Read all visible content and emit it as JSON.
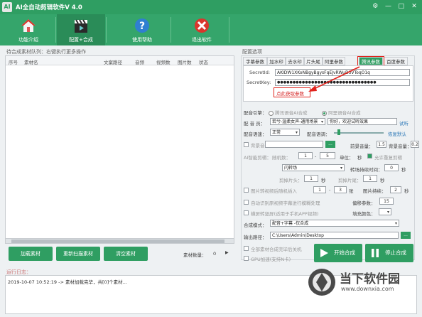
{
  "window": {
    "title": "AI全自动剪辑软件V 4.0",
    "logo_text": "AI"
  },
  "toolbar": [
    {
      "label": "功能介绍",
      "icon": "home-icon"
    },
    {
      "label": "配置+合成",
      "icon": "clapperboard-icon"
    },
    {
      "label": "使用帮助",
      "icon": "help-icon"
    },
    {
      "label": "退出软件",
      "icon": "exit-icon"
    }
  ],
  "left": {
    "section_title": "待合成素材队列：右键执行更多操作",
    "columns": [
      "序号",
      "素材名",
      "文案路径",
      "音频",
      "视频数",
      "图片数",
      "状态"
    ],
    "buttons": {
      "load": "加载素材",
      "rescan": "重新扫描素材",
      "clear": "清空素材"
    },
    "count_label": "素材数量：",
    "count_value": "0"
  },
  "right": {
    "section_title": "配置选项",
    "tabs": [
      "字幕参数",
      "加水印",
      "去水印",
      "片头尾",
      "阿里参数",
      "腾讯参数",
      "百度参数"
    ],
    "active_tab": "腾讯参数",
    "secret_id_label": "SecretId:",
    "secret_id_value": "AKIDW1XKoNBgyBgysFqEJvRWuD3VToqO1q",
    "secret_key_label": "SecretKey:",
    "secret_key_value": "●●●●●●●●●●●●●●●●●●●●●●●●●●●●●●●●",
    "get_params_link": "点此获取参数",
    "engine_label": "配音引擎：",
    "engine_opt1": "腾讯语音AI合成",
    "engine_opt2": "阿里语音AI合成",
    "voice_label": "配 音 员：",
    "voice_value": "若兮-温柔女声-通用场景",
    "voice_text_value": "你好，欢迎试听效果",
    "voice_try": "试听",
    "speed_label": "配音语速：",
    "speed_value": "正常",
    "tone_label": "配音语调：",
    "restore_default": "恢复默认",
    "bgm_label": "背景音",
    "foreground_vol_label": "前景音量：",
    "foreground_vol": "1.5",
    "bg_vol_label": "背景音量：",
    "bg_vol": "0.2",
    "ai_cut_label": "AI智能剪辑：",
    "random_label": "随机数：",
    "random_from": "1",
    "random_to": "5",
    "unit_label": "单位：",
    "unit_value": "秒",
    "allow_repeat": "允许重复剪辑",
    "transition_value": "闪转场",
    "transition_time_label": "转场持续时间：",
    "transition_time": "0",
    "seconds": "秒",
    "cut_head_label": "剪掉片头：",
    "cut_head": "1",
    "cut_tail_label": "剪掉片尾：",
    "cut_tail": "1",
    "image_insert_label": "图片转视频后随机插入",
    "image_from": "1",
    "image_to": "3",
    "image_unit": "张",
    "image_duration_label": "图片持续：",
    "image_duration": "2",
    "auto_blur_label": "自动识别原视频字幕进行模糊处理",
    "offset_label": "偏移参数：",
    "offset_value": "15",
    "vertical_fill_label": "横屏转竖屏(适用于手机APP视频)",
    "fill_color_label": "填充颜色：",
    "compose_mode_label": "合成模式：",
    "compose_mode_value": "配音+字幕 -仅合成",
    "output_label": "输出路径：",
    "output_value": "C:\\Users\\Admin\\Desktop",
    "output_browse": "...",
    "compose_all_label": "全部素材合成完毕后关机",
    "gpu_label": "GPU加速(支持N卡)",
    "start_button": "开始合成",
    "stop_button": "停止合成"
  },
  "log": {
    "section_title": "运行日志：",
    "line": "2019-10-07 10:52:19 -> 素材加载完毕，共[0]个素材..."
  },
  "watermark": {
    "text_cn": "当下软件园",
    "text_url": "www.downxia.com"
  },
  "colors": {
    "primary": "#2f9e62",
    "highlight_red": "#e0231c"
  }
}
